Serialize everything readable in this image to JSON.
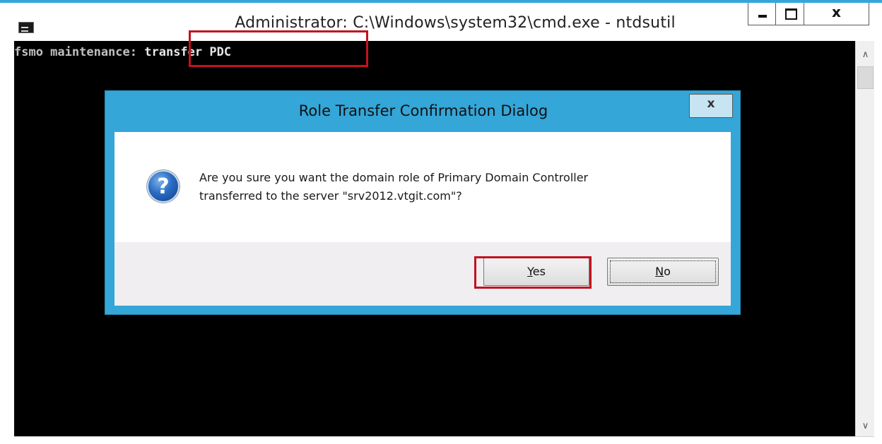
{
  "window": {
    "title": "Administrator: C:\\Windows\\system32\\cmd.exe - ntdsutil",
    "controls": {
      "minimize": "minimize",
      "maximize": "maximize",
      "close_label": "x"
    }
  },
  "console": {
    "prompt": "fsmo maintenance:",
    "command": "transfer PDC"
  },
  "dialog": {
    "title": "Role Transfer Confirmation Dialog",
    "close_label": "x",
    "message_line1": "Are you sure you want the domain role of Primary Domain Controller",
    "message_line2": "transferred to the server \"srv2012.vtgit.com\"?",
    "icon": "question-icon",
    "buttons": {
      "yes_accel": "Y",
      "yes_rest": "es",
      "no_accel": "N",
      "no_rest": "o"
    }
  },
  "colors": {
    "dialog_frame": "#34a6d8",
    "highlight": "#c1121f",
    "console_bg": "#000000"
  }
}
